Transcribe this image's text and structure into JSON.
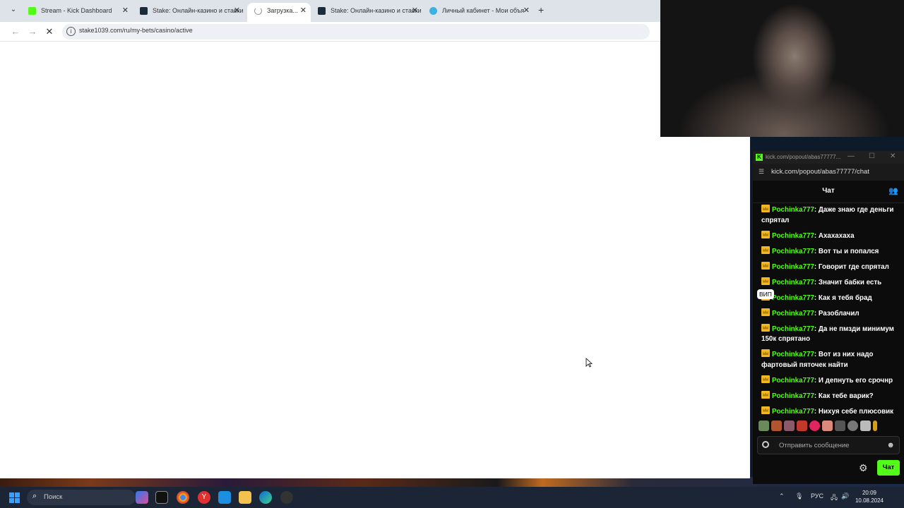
{
  "browser": {
    "tabs": [
      {
        "label": "Stream - Kick Dashboard",
        "fav_color": "#53fc18",
        "active": false
      },
      {
        "label": "Stake: Онлайн-казино и ставки",
        "fav_color": "#1a2c38",
        "active": false
      },
      {
        "label": "Загрузка...",
        "fav_color": "#999999",
        "active": true
      },
      {
        "label": "Stake: Онлайн-казино и ставки",
        "fav_color": "#1a2c38",
        "active": false
      },
      {
        "label": "Личный кабинет - Мои объя",
        "fav_color": "#3fb1e0",
        "active": false
      }
    ],
    "new_tab": "+",
    "url": "stake1039.com/ru/my-bets/casino/active"
  },
  "chat": {
    "window_title": "kick.com/popout/abas77777...",
    "url": "kick.com/popout/abas77777/chat",
    "header": "Чат",
    "messages": [
      {
        "user": "Pochinka777",
        "text": ": Даже знаю где деньги спрятал"
      },
      {
        "user": "Pochinka777",
        "text": ": Ахахахаха"
      },
      {
        "user": "Pochinka777",
        "text": ": Вот ты и попался"
      },
      {
        "user": "Pochinka777",
        "text": ": Говорит где спрятал"
      },
      {
        "user": "Pochinka777",
        "text": ": Значит бабки есть"
      },
      {
        "user": "Pochinka777",
        "text": ": Как я тебя брад"
      },
      {
        "user": "Pochinka777",
        "text": ": Разоблачил"
      },
      {
        "user": "Pochinka777",
        "text": ": Да не пмзди минимум 150к спрятано"
      },
      {
        "user": "Pochinka777",
        "text": ": Вот из них надо фартовый пяточек найти"
      },
      {
        "user": "Pochinka777",
        "text": ": И депнуть его срочнр"
      },
      {
        "user": "Pochinka777",
        "text": ": Как тебе варик?"
      },
      {
        "user": "Pochinka777",
        "text": ": Нихуя себе плюсовик"
      }
    ],
    "vip_tooltip": "ВИП",
    "input_placeholder": "Отправить сообщение",
    "send_label": "Чат",
    "accent": "#53fc18"
  },
  "taskbar": {
    "search_placeholder": "Поиск",
    "language": "РУС",
    "time": "20:09",
    "date": "10.08.2024"
  }
}
